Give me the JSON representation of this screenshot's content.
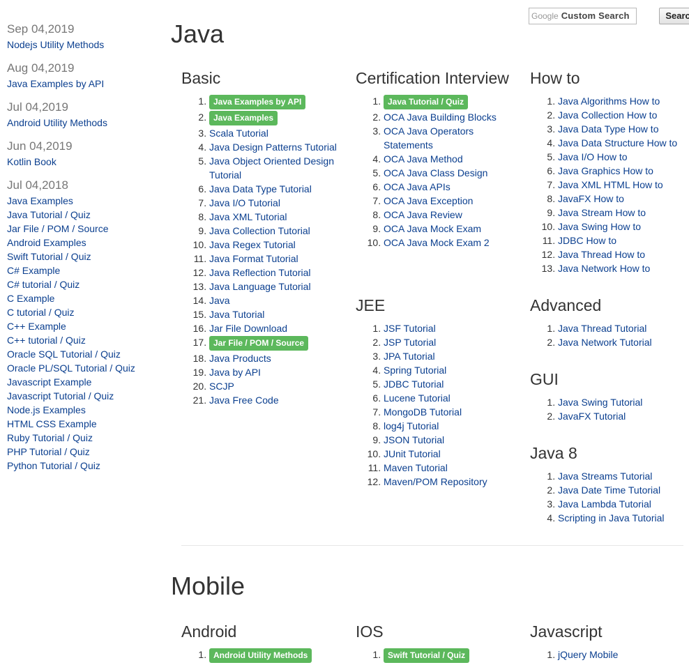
{
  "search": {
    "brand": "Google",
    "placeholder": "Custom Search",
    "button_label": "Search"
  },
  "sidebar": [
    {
      "date": "Sep 04,2019",
      "links": [
        "Nodejs Utility Methods"
      ]
    },
    {
      "date": "Aug 04,2019",
      "links": [
        "Java Examples by API"
      ]
    },
    {
      "date": "Jul 04,2019",
      "links": [
        "Android Utility Methods"
      ]
    },
    {
      "date": "Jun 04,2019",
      "links": [
        "Kotlin Book"
      ]
    },
    {
      "date": "Jul 04,2018",
      "links": [
        "Java Examples",
        "Java Tutorial / Quiz",
        "Jar File / POM / Source",
        "Android Examples",
        "Swift Tutorial / Quiz",
        "C# Example",
        "C# tutorial / Quiz",
        "C Example",
        "C tutorial / Quiz",
        "C++ Example",
        "C++ tutorial / Quiz",
        "Oracle SQL Tutorial / Quiz",
        "Oracle PL/SQL Tutorial / Quiz",
        "Javascript Example",
        "Javascript Tutorial / Quiz",
        "Node.js Examples",
        "HTML CSS Example",
        "Ruby Tutorial / Quiz",
        "PHP Tutorial / Quiz",
        "Python Tutorial / Quiz"
      ]
    }
  ],
  "sections": {
    "java": {
      "title": "Java",
      "basic": {
        "title": "Basic",
        "items": [
          {
            "label": "Java Examples by API",
            "badge": true
          },
          {
            "label": "Java Examples",
            "badge": true
          },
          {
            "label": "Scala Tutorial"
          },
          {
            "label": "Java Design Patterns Tutorial"
          },
          {
            "label": "Java Object Oriented Design Tutorial"
          },
          {
            "label": "Java Data Type Tutorial"
          },
          {
            "label": "Java I/O Tutorial"
          },
          {
            "label": "Java XML Tutorial"
          },
          {
            "label": "Java Collection Tutorial"
          },
          {
            "label": "Java Regex Tutorial"
          },
          {
            "label": "Java Format Tutorial"
          },
          {
            "label": "Java Reflection Tutorial"
          },
          {
            "label": "Java Language Tutorial"
          },
          {
            "label": "Java"
          },
          {
            "label": "Java Tutorial"
          },
          {
            "label": "Jar File Download"
          },
          {
            "label": "Jar File / POM / Source",
            "badge": true
          },
          {
            "label": "Java Products"
          },
          {
            "label": "Java by API"
          },
          {
            "label": "SCJP"
          },
          {
            "label": "Java Free Code"
          }
        ]
      },
      "cert": {
        "title": "Certification Interview",
        "items": [
          {
            "label": "Java Tutorial / Quiz",
            "badge": true
          },
          {
            "label": "OCA Java Building Blocks"
          },
          {
            "label": "OCA Java Operators Statements"
          },
          {
            "label": "OCA Java Method"
          },
          {
            "label": "OCA Java Class Design"
          },
          {
            "label": "OCA Java APIs"
          },
          {
            "label": "OCA Java Exception"
          },
          {
            "label": "OCA Java Review"
          },
          {
            "label": "OCA Java Mock Exam"
          },
          {
            "label": "OCA Java Mock Exam 2"
          }
        ]
      },
      "jee": {
        "title": "JEE",
        "items": [
          {
            "label": "JSF Tutorial"
          },
          {
            "label": "JSP Tutorial"
          },
          {
            "label": "JPA Tutorial"
          },
          {
            "label": "Spring Tutorial"
          },
          {
            "label": "JDBC Tutorial"
          },
          {
            "label": "Lucene Tutorial"
          },
          {
            "label": "MongoDB Tutorial"
          },
          {
            "label": "log4j Tutorial"
          },
          {
            "label": "JSON Tutorial"
          },
          {
            "label": "JUnit Tutorial"
          },
          {
            "label": "Maven Tutorial"
          },
          {
            "label": "Maven/POM Repository"
          }
        ]
      },
      "howto": {
        "title": "How to",
        "items": [
          {
            "label": "Java Algorithms How to"
          },
          {
            "label": "Java Collection How to"
          },
          {
            "label": "Java Data Type How to"
          },
          {
            "label": "Java Data Structure How to"
          },
          {
            "label": "Java I/O How to"
          },
          {
            "label": "Java Graphics How to"
          },
          {
            "label": "Java XML HTML How to"
          },
          {
            "label": "JavaFX How to"
          },
          {
            "label": "Java Stream How to"
          },
          {
            "label": "Java Swing How to"
          },
          {
            "label": "JDBC How to"
          },
          {
            "label": "Java Thread How to"
          },
          {
            "label": "Java Network How to"
          }
        ]
      },
      "advanced": {
        "title": "Advanced",
        "items": [
          {
            "label": "Java Thread Tutorial"
          },
          {
            "label": "Java Network Tutorial"
          }
        ]
      },
      "gui": {
        "title": "GUI",
        "items": [
          {
            "label": "Java Swing Tutorial"
          },
          {
            "label": "JavaFX Tutorial"
          }
        ]
      },
      "java8": {
        "title": "Java 8",
        "items": [
          {
            "label": "Java Streams Tutorial"
          },
          {
            "label": "Java Date Time Tutorial"
          },
          {
            "label": "Java Lambda Tutorial"
          },
          {
            "label": "Scripting in Java Tutorial"
          }
        ]
      }
    },
    "mobile": {
      "title": "Mobile",
      "android": {
        "title": "Android",
        "items": [
          {
            "label": "Android Utility Methods",
            "badge": true
          }
        ]
      },
      "ios": {
        "title": "IOS",
        "items": [
          {
            "label": "Swift Tutorial / Quiz",
            "badge": true
          }
        ]
      },
      "javascript": {
        "title": "Javascript",
        "items": [
          {
            "label": "jQuery Mobile"
          }
        ]
      }
    }
  },
  "colors": {
    "badge": "#5cb85c",
    "link": "#0b3f8f",
    "date": "#777777"
  }
}
